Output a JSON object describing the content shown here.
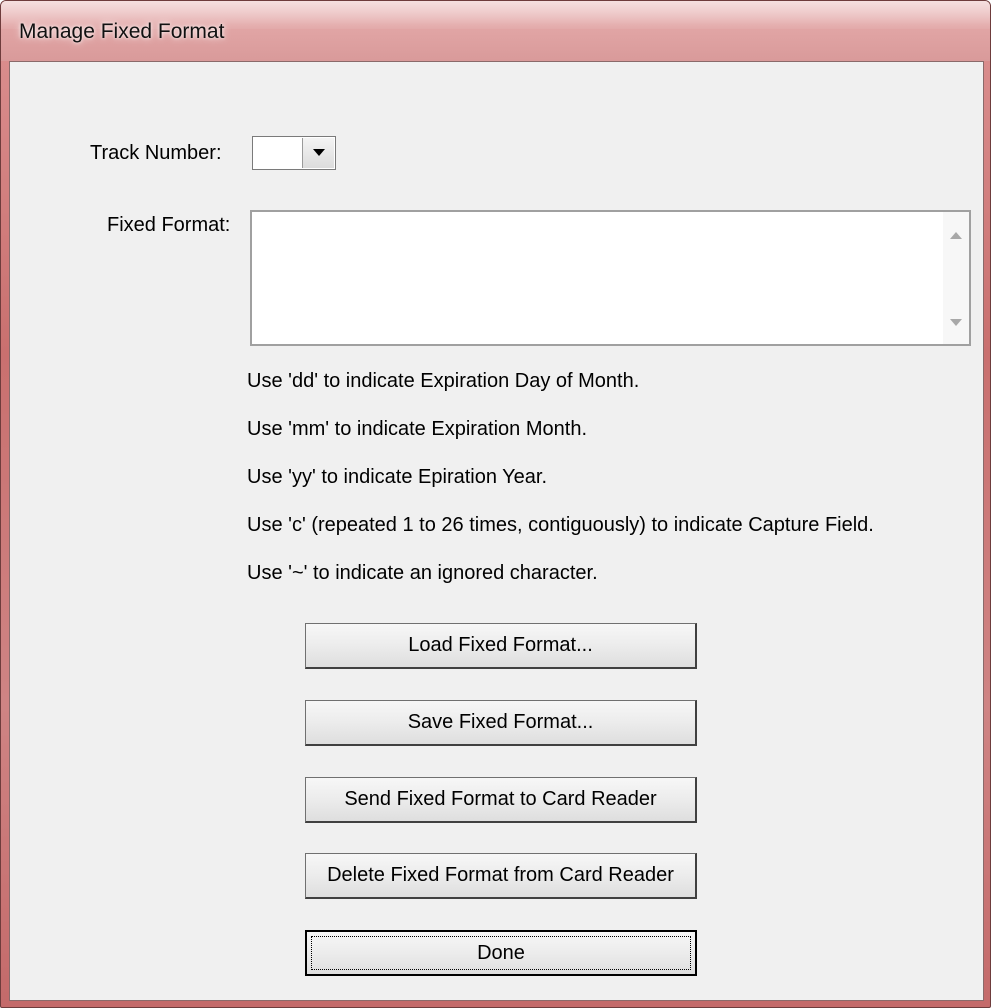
{
  "window": {
    "title": "Manage Fixed Format"
  },
  "form": {
    "track_number_label": "Track Number:",
    "track_number_value": "",
    "fixed_format_label": "Fixed Format:",
    "fixed_format_value": ""
  },
  "hints": [
    "Use 'dd' to indicate Expiration Day of Month.",
    "Use 'mm' to indicate Expiration Month.",
    "Use 'yy' to indicate Epiration Year.",
    "Use 'c' (repeated 1 to 26 times, contiguously) to indicate Capture Field.",
    "Use '~' to indicate an ignored character."
  ],
  "buttons": {
    "load": "Load Fixed Format...",
    "save": "Save Fixed Format...",
    "send": "Send Fixed Format to Card Reader",
    "delete": "Delete Fixed Format from Card Reader",
    "done": "Done"
  },
  "icons": [
    "chevron-down-icon",
    "scroll-up-icon",
    "scroll-down-icon"
  ]
}
